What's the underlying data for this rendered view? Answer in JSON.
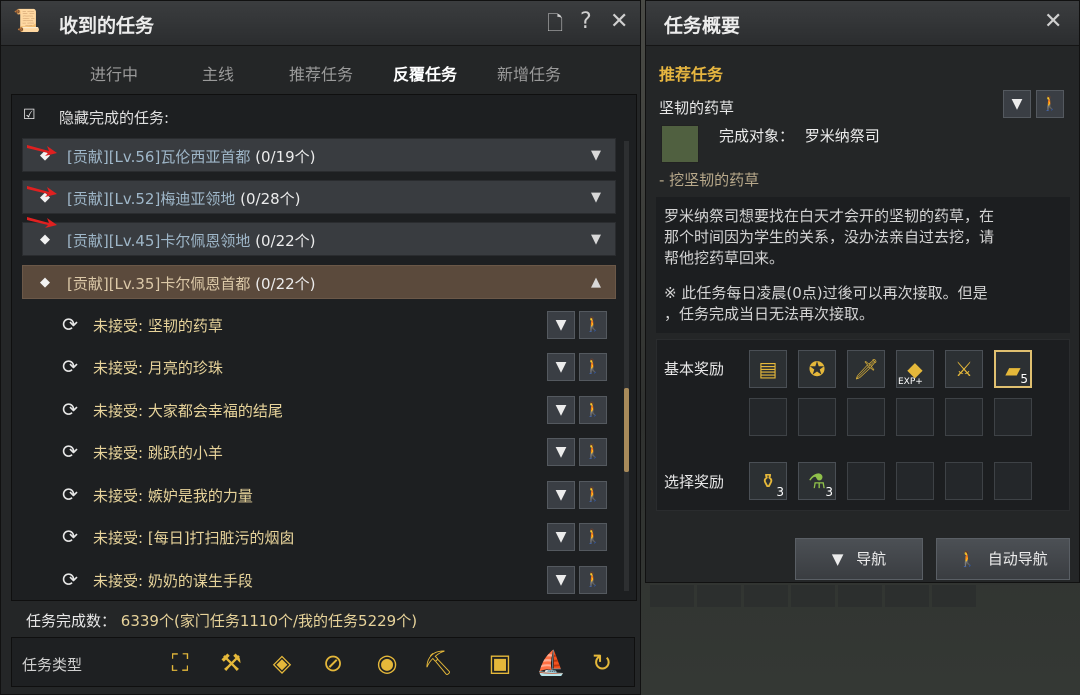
{
  "left_panel": {
    "title": "收到的任务",
    "tabs": [
      {
        "label": "进行中",
        "active": false
      },
      {
        "label": "主线",
        "active": false
      },
      {
        "label": "推荐任务",
        "active": false
      },
      {
        "label": "反覆任务",
        "active": true
      },
      {
        "label": "新增任务",
        "active": false
      }
    ],
    "hide_completed": {
      "label": "隐藏完成的任务:",
      "checked": true
    },
    "groups": [
      {
        "label": "[贡献][Lv.56]瓦伦西亚首都",
        "count": "(0/19个)",
        "expanded": false
      },
      {
        "label": "[贡献][Lv.52]梅迪亚领地",
        "count": "(0/28个)",
        "expanded": false
      },
      {
        "label": "[贡献][Lv.45]卡尔佩恩领地",
        "count": "(0/22个)",
        "expanded": false
      },
      {
        "label": "[贡献][Lv.35]卡尔佩恩首都",
        "count": "(0/22个)",
        "expanded": true
      }
    ],
    "quests": [
      {
        "status": "未接受:",
        "name": "坚韧的药草"
      },
      {
        "status": "未接受:",
        "name": "月亮的珍珠"
      },
      {
        "status": "未接受:",
        "name": "大家都会幸福的结尾"
      },
      {
        "status": "未接受:",
        "name": "跳跃的小羊"
      },
      {
        "status": "未接受:",
        "name": "嫉妒是我的力量"
      },
      {
        "status": "未接受:",
        "name": "[每日]打扫脏污的烟囱"
      },
      {
        "status": "未接受:",
        "name": "奶奶的谋生手段"
      }
    ],
    "summary": {
      "label": "任务完成数：",
      "value": "6339个(家门任务1110个/我的任务5229个)"
    },
    "quest_types_label": "任务类型"
  },
  "right_panel": {
    "title": "任务概要",
    "section_title": "推荐任务",
    "quest_name": "坚韧的药草",
    "target_label": "完成对象：",
    "target_value": "罗米纳祭司",
    "subtask": "- 挖坚韧的药草",
    "description": [
      "罗米纳祭司想要找在白天才会开的坚韧的药草，在",
      "那个时间因为学生的关系，没办法亲自过去挖，请",
      "帮他挖药草回来。"
    ],
    "note": [
      "※  此任务每日凌晨(0点)过後可以再次接取。但是",
      "，任务完成当日无法再次接取。"
    ],
    "basic_reward_label": "基本奖励",
    "basic_rewards": [
      {
        "icon": "scroll-icon",
        "count": ""
      },
      {
        "icon": "medal-icon",
        "count": ""
      },
      {
        "icon": "dagger-icon",
        "count": ""
      },
      {
        "icon": "exp-gem-icon",
        "count": "",
        "badge": "EXP+"
      },
      {
        "icon": "golden-sword-icon",
        "count": ""
      },
      {
        "icon": "book-icon",
        "count": "5"
      }
    ],
    "choice_reward_label": "选择奖励",
    "choice_rewards": [
      {
        "icon": "potion-bottle-icon",
        "count": "3"
      },
      {
        "icon": "green-elixir-icon",
        "count": "3"
      }
    ],
    "nav_button": "导航",
    "auto_nav_button": "自动导航"
  },
  "colors": {
    "accent": "#e7b640",
    "quest_text": "#e7d39a",
    "panel": "#242627"
  }
}
